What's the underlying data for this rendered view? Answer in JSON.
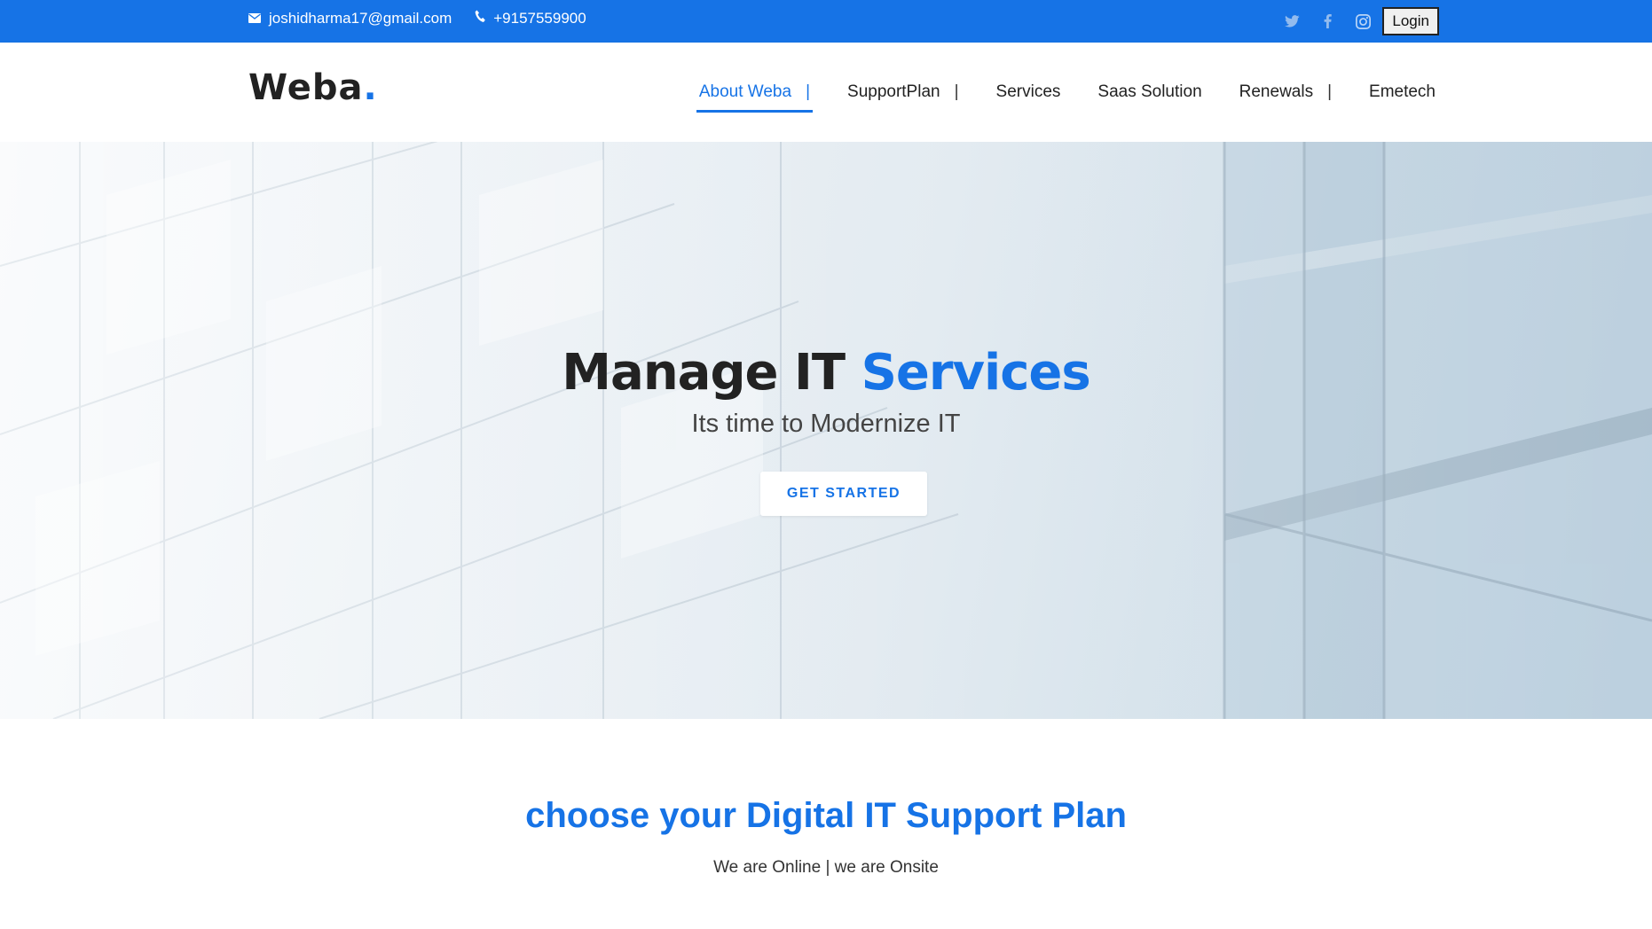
{
  "topbar": {
    "email": "joshidharma17@gmail.com",
    "phone": "+9157559900",
    "icons": {
      "email": "envelope-icon",
      "phone": "phone-icon",
      "twitter": "twitter-icon",
      "facebook": "facebook-icon",
      "instagram": "instagram-icon"
    },
    "login_label": "Login"
  },
  "header": {
    "logo": {
      "text": "Weba",
      "dot": "."
    },
    "nav": [
      {
        "label": "About Weba",
        "separator": "|",
        "active": true
      },
      {
        "label": "SupportPlan",
        "separator": "|"
      },
      {
        "label": "Services"
      },
      {
        "label": "Saas Solution"
      },
      {
        "label": "Renewals",
        "separator": "|"
      },
      {
        "label": "Emetech"
      }
    ]
  },
  "hero": {
    "title_main": "Manage IT ",
    "title_accent": "Services",
    "subtitle": "Its time to Modernize IT",
    "cta_label": "GET STARTED"
  },
  "support": {
    "title": "choose your Digital IT Support Plan",
    "subtitle": "We are Online | we are Onsite"
  },
  "colors": {
    "brand": "#1673e6",
    "text_dark": "#222222",
    "hero_bg": "#dfe8ef"
  }
}
